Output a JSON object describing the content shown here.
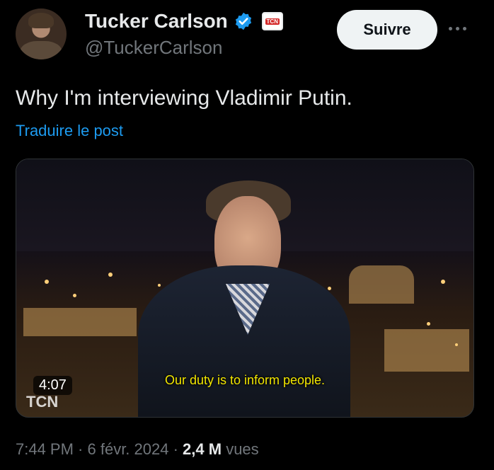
{
  "author": {
    "name": "Tucker Carlson",
    "handle": "@TuckerCarlson",
    "badge_text": "TCN"
  },
  "actions": {
    "follow_label": "Suivre"
  },
  "post": {
    "text": "Why I'm interviewing Vladimir Putin.",
    "translate_label": "Traduire le post"
  },
  "media": {
    "subtitle": "Our duty is to inform people.",
    "duration": "4:07",
    "watermark": "TCN"
  },
  "meta": {
    "time": "7:44 PM",
    "sep1": " · ",
    "date": "6 févr. 2024",
    "sep2": " · ",
    "views_count": "2,4 M",
    "views_label": " vues"
  },
  "colors": {
    "accent": "#1d9bf0",
    "text": "#e7e9ea",
    "muted": "#71767b",
    "background": "#000000"
  }
}
